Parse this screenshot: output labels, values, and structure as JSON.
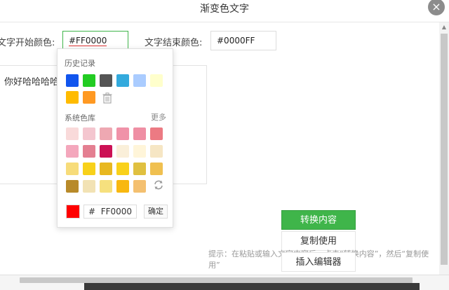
{
  "dialog": {
    "title": "渐变色文字",
    "close": "×"
  },
  "form": {
    "start_label": "文字开始颜色:",
    "start_value": "#FF0000",
    "end_label": "文字结束颜色:",
    "end_value": "#0000FF"
  },
  "editor": {
    "content": "你好哈哈哈哈"
  },
  "picker": {
    "history_title": "历史记录",
    "history_colors": [
      "#1155ee",
      "#22cc22",
      "#555555",
      "#33aadd",
      "#aaccff",
      "#ffffcc",
      "#ffbb00",
      "#ff9922"
    ],
    "library_title": "系统色库",
    "more": "更多",
    "library_colors": [
      [
        "#f9dada",
        "#f4c6cf",
        "#eea8b2",
        "#f092a8",
        "#ef8fa4",
        "#ec7a83"
      ],
      [
        "#f4a7bc",
        "#e47f91",
        "#cc1155",
        "#faefd9",
        "#fff5d9",
        "#f6e6c4"
      ],
      [
        "#f7dc7a",
        "#f8d11a",
        "#e8b820",
        "#f9d11a",
        "#e0c040",
        "#f0c050"
      ],
      [
        "#b88a2a",
        "#f2e2b4",
        "#f6e07e",
        "#f8b810",
        "#f4c070"
      ]
    ],
    "current_color": "#ff0000",
    "hex_prefix": "#",
    "hex_value": "FF0000",
    "ok": "确定"
  },
  "buttons": {
    "convert": "转换内容",
    "copy": "复制使用",
    "insert": "插入编辑器"
  },
  "hint": "提示：在粘贴或输入文字内容后，点击“转换内容”，然后“复制使用”"
}
